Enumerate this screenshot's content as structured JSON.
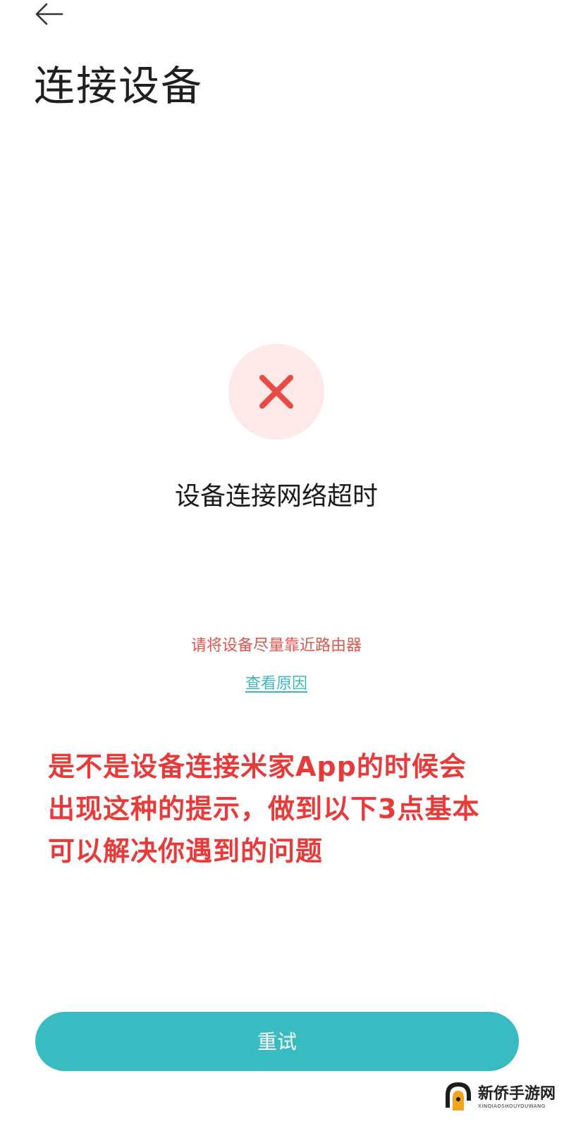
{
  "header": {
    "back_icon": "arrow-left-icon",
    "title": "连接设备"
  },
  "status": {
    "icon": "close-x-icon",
    "icon_color": "#e94a45",
    "icon_bg": "#fce9e8",
    "title": "设备连接网络超时",
    "hint": "请将设备尽量靠近路由器",
    "hint_color": "#e0564f",
    "reason_link": "查看原因",
    "link_color": "#3cb8bc"
  },
  "annotation": {
    "lines": [
      "是不是设备连接米家App的时候会",
      "出现这种的提示，做到以下3点基本",
      "可以解决你遇到的问题"
    ],
    "color": "#e93a3a"
  },
  "footer": {
    "retry_label": "重试",
    "button_color": "#38bcc1"
  },
  "watermark": {
    "name": "新侨手游网",
    "sub": "XINQIAOSHOUYOUWANG"
  }
}
